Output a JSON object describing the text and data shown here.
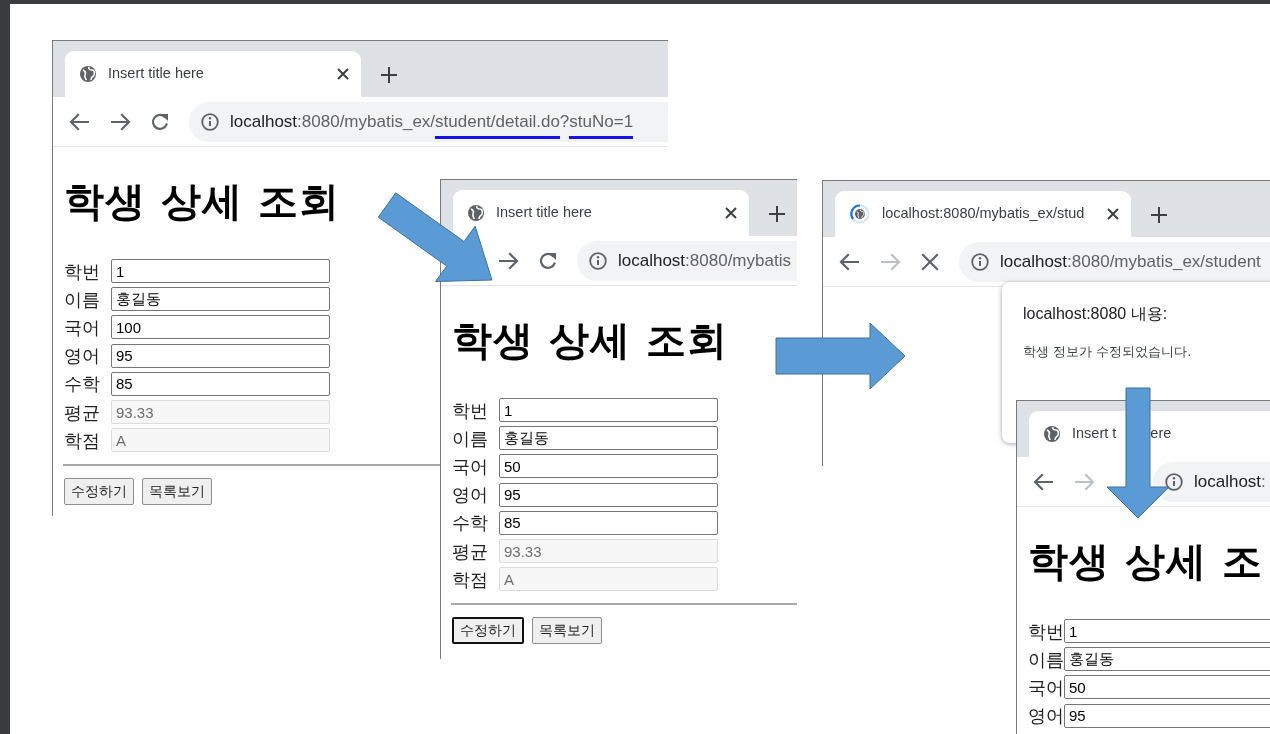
{
  "windows": [
    {
      "tab": {
        "title_parts": [
          "Insert title here"
        ],
        "loading": false
      },
      "nav": [
        {
          "kind": "back",
          "disabled": false
        },
        {
          "kind": "forward",
          "disabled": false
        },
        {
          "kind": "reload",
          "disabled": false
        }
      ],
      "address": [
        {
          "text": "localhost",
          "kind": "host",
          "underlined": false
        },
        {
          "text": ":8080/mybatis_ex/",
          "kind": "path",
          "underlined": false
        },
        {
          "text": "student/detail.do",
          "kind": "path",
          "underlined": true
        },
        {
          "text": "?",
          "kind": "path",
          "underlined": false
        },
        {
          "text": "stuNo=1",
          "kind": "path",
          "underlined": true
        }
      ],
      "page": {
        "heading": "학생 상세 조회",
        "fields": [
          {
            "label": "학번",
            "value": "1",
            "readonly": false
          },
          {
            "label": "이름",
            "value": "홍길동",
            "readonly": false
          },
          {
            "label": "국어",
            "value": "100",
            "readonly": false
          },
          {
            "label": "영어",
            "value": "95",
            "readonly": false
          },
          {
            "label": "수학",
            "value": "85",
            "readonly": false
          },
          {
            "label": "평균",
            "value": "93.33",
            "readonly": true
          },
          {
            "label": "학점",
            "value": "A",
            "readonly": true
          }
        ],
        "buttons": [
          {
            "label": "수정하기",
            "focused": false
          },
          {
            "label": "목록보기",
            "focused": false
          }
        ]
      }
    },
    {
      "tab": {
        "title_parts": [
          "Insert title here"
        ],
        "loading": false
      },
      "nav": [
        {
          "kind": "forward",
          "disabled": false
        },
        {
          "kind": "reload",
          "disabled": false
        }
      ],
      "address": [
        {
          "text": "localhost",
          "kind": "host",
          "underlined": false
        },
        {
          "text": ":8080/mybatis",
          "kind": "path",
          "underlined": false
        }
      ],
      "page": {
        "heading": "학생 상세 조회",
        "fields": [
          {
            "label": "학번",
            "value": "1",
            "readonly": false
          },
          {
            "label": "이름",
            "value": "홍길동",
            "readonly": false
          },
          {
            "label": "국어",
            "value": "50",
            "readonly": false
          },
          {
            "label": "영어",
            "value": "95",
            "readonly": false
          },
          {
            "label": "수학",
            "value": "85",
            "readonly": false
          },
          {
            "label": "평균",
            "value": "93.33",
            "readonly": true
          },
          {
            "label": "학점",
            "value": "A",
            "readonly": true
          }
        ],
        "buttons": [
          {
            "label": "수정하기",
            "focused": true
          },
          {
            "label": "목록보기",
            "focused": false
          }
        ]
      }
    },
    {
      "tab": {
        "title_parts": [
          "localhost:8080/mybatis_ex/stud"
        ],
        "loading": true
      },
      "nav": [
        {
          "kind": "back",
          "disabled": false
        },
        {
          "kind": "forward",
          "disabled": true
        },
        {
          "kind": "stop",
          "disabled": false
        }
      ],
      "address": [
        {
          "text": "localhost",
          "kind": "host",
          "underlined": false
        },
        {
          "text": ":8080/mybatis_ex/student",
          "kind": "path",
          "underlined": false
        }
      ],
      "alert": {
        "title": "localhost:8080 내용:",
        "message": "학생 정보가 수정되었습니다."
      }
    },
    {
      "tab": {
        "title_parts": [
          "Insert t",
          "ere"
        ],
        "loading": false
      },
      "nav": [
        {
          "kind": "back",
          "disabled": false
        },
        {
          "kind": "forward",
          "disabled": true
        }
      ],
      "address": [
        {
          "text": "localhost",
          "kind": "host",
          "underlined": false
        },
        {
          "text": ":",
          "kind": "path",
          "underlined": false
        }
      ],
      "page": {
        "heading": "학생 상세 조",
        "fields": [
          {
            "label": "학번",
            "value": "1",
            "readonly": false
          },
          {
            "label": "이름",
            "value": "홍길동",
            "readonly": false
          },
          {
            "label": "국어",
            "value": "50",
            "readonly": false
          },
          {
            "label": "영어",
            "value": "95",
            "readonly": false
          }
        ]
      }
    }
  ]
}
